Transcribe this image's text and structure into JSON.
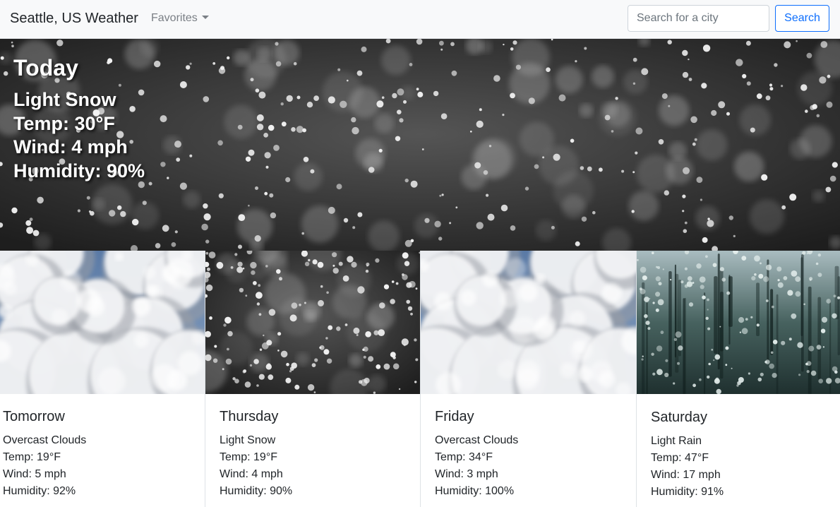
{
  "navbar": {
    "brand": "Seattle, US Weather",
    "favorites_label": "Favorites",
    "search_placeholder": "Search for a city",
    "search_button": "Search"
  },
  "today": {
    "title": "Today",
    "condition": "Light Snow",
    "temp": "Temp: 30°F",
    "wind": "Wind: 4 mph",
    "humidity": "Humidity: 90%",
    "background": "snow"
  },
  "forecast": [
    {
      "day": "Tomorrow",
      "condition": "Overcast Clouds",
      "temp": "Temp: 19°F",
      "wind": "Wind: 5 mph",
      "humidity": "Humidity: 92%",
      "image": "clouds"
    },
    {
      "day": "Thursday",
      "condition": "Light Snow",
      "temp": "Temp: 19°F",
      "wind": "Wind: 4 mph",
      "humidity": "Humidity: 90%",
      "image": "snow"
    },
    {
      "day": "Friday",
      "condition": "Overcast Clouds",
      "temp": "Temp: 34°F",
      "wind": "Wind: 3 mph",
      "humidity": "Humidity: 100%",
      "image": "clouds"
    },
    {
      "day": "Saturday",
      "condition": "Light Rain",
      "temp": "Temp: 47°F",
      "wind": "Wind: 17 mph",
      "humidity": "Humidity: 91%",
      "image": "rain"
    }
  ],
  "colors": {
    "navbar_bg": "#f8f9fa",
    "accent": "#0d6efd"
  }
}
